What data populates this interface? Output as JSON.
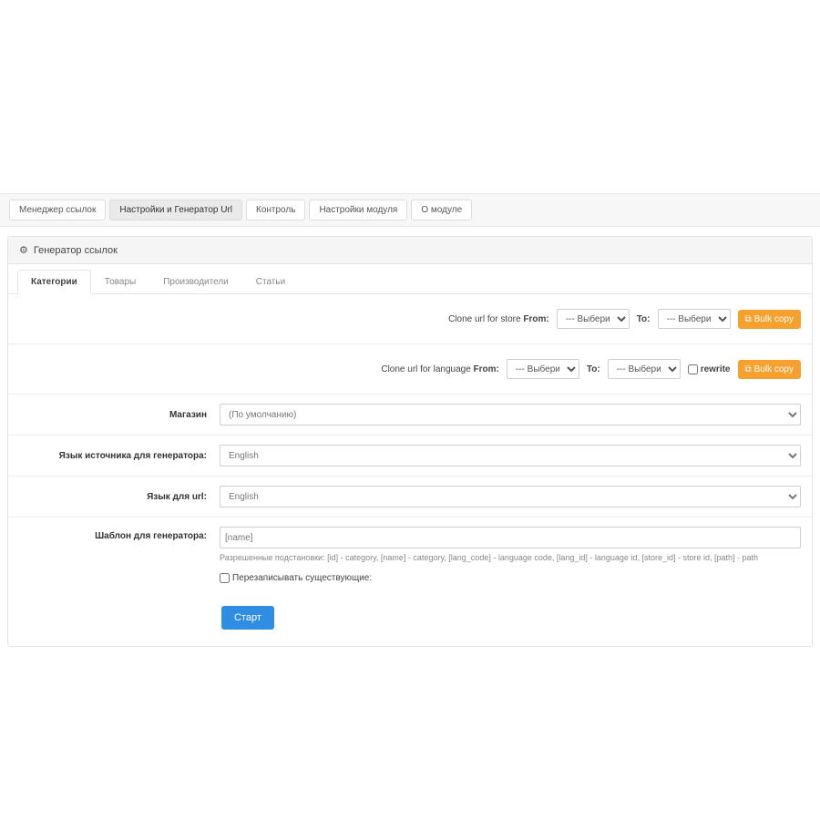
{
  "mainTabs": {
    "linkManager": "Менеджер ссылок",
    "urlGenerator": "Настройки и Генератор Url",
    "control": "Контроль",
    "moduleSettings": "Настройки модуля",
    "about": "О модуле"
  },
  "panel": {
    "title": "Генератор ссылок"
  },
  "subTabs": {
    "categories": "Категории",
    "products": "Товары",
    "manufacturers": "Производители",
    "articles": "Статьи"
  },
  "cloneStore": {
    "label": "Clone url for store",
    "from": "From:",
    "to": "To:",
    "selectPlaceholder": "--- Выберите ---",
    "button": "Bulk copy"
  },
  "cloneLang": {
    "label": "Clone url for language",
    "from": "From:",
    "to": "To:",
    "selectPlaceholder": "--- Выберите ---",
    "rewrite": "rewrite",
    "button": "Bulk copy"
  },
  "form": {
    "storeLabel": "Магазин",
    "storeValue": "(По умолчанию)",
    "sourceLangLabel": "Язык источника для генератора:",
    "sourceLangValue": "English",
    "urlLangLabel": "Язык для url:",
    "urlLangValue": "English",
    "templateLabel": "Шаблон для генератора:",
    "templateValue": "[name]",
    "templateHint": "Разрешенные подстановки: [id] - category, [name] - category, [lang_code] - language code, [lang_id] - language id, [store_id] - store id, [path] - path",
    "overwriteLabel": "Перезаписывать существующие:",
    "startButton": "Старт"
  }
}
